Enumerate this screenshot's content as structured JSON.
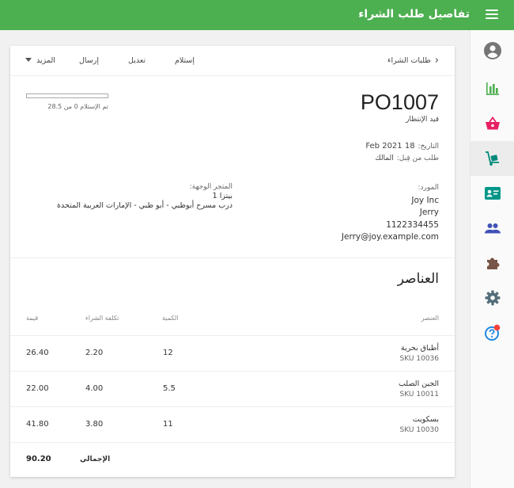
{
  "app": {
    "title": "تفاصيل طلب الشراء"
  },
  "colors": {
    "primary": "#4caf50",
    "chart": "#4caf50",
    "basket": "#e91e63",
    "cart": "#00897b",
    "contact": "#009688",
    "people": "#3f51b5",
    "puzzle": "#795548",
    "gear": "#546e7a",
    "help": "#1e88e5",
    "badge": "#f44336",
    "account": "#757575"
  },
  "nav": [
    {
      "icon": "account-circle-icon"
    },
    {
      "icon": "bar-chart-icon"
    },
    {
      "icon": "shopping-basket-icon"
    },
    {
      "icon": "dolly-cart-icon",
      "active": true
    },
    {
      "icon": "contact-card-icon"
    },
    {
      "icon": "people-icon"
    },
    {
      "icon": "puzzle-icon"
    },
    {
      "icon": "gear-icon"
    },
    {
      "icon": "help-icon"
    }
  ],
  "toolbar": {
    "breadcrumb": "طلبات الشراء",
    "receive": "إستلام",
    "edit": "تعديل",
    "send": "إرسال",
    "more": "المزيد"
  },
  "po": {
    "number": "PO1007",
    "status": "قيد الإنتظار",
    "date_label": "التاريخ:",
    "date_value": "18 Feb 2021",
    "ordered_by_label": "طلب من قِبل:",
    "ordered_by_value": "المالك",
    "received_label": "تم الإستلام 0 من 28.5",
    "received_progress": 0
  },
  "vendor": {
    "label": "المورد:",
    "lines": [
      "Joy Inc",
      "Jerry",
      "1122334455",
      "Jerry@joy.example.com"
    ]
  },
  "store": {
    "label": "المتجر الوجهة:",
    "name": "بيتزا 1",
    "address": "درب مسرح أبوظبي - أبو ظبي - الإمارات العربية المتحدة"
  },
  "items": {
    "title": "العناصر",
    "headers": {
      "item": "العنصر",
      "quantity": "الكمية",
      "purchase_cost": "تكلفة الشراء",
      "value": "قيمة"
    },
    "rows": [
      {
        "name": "أطباق بحرية",
        "sku": "SKU 10036",
        "quantity": "12",
        "cost": "2.20",
        "value": "26.40"
      },
      {
        "name": "الجبن الصلب",
        "sku": "SKU 10011",
        "quantity": "5.5",
        "cost": "4.00",
        "value": "22.00"
      },
      {
        "name": "بسكويت",
        "sku": "SKU 10030",
        "quantity": "11",
        "cost": "3.80",
        "value": "41.80"
      }
    ],
    "total_label": "الإجمالي",
    "total_value": "90.20"
  }
}
